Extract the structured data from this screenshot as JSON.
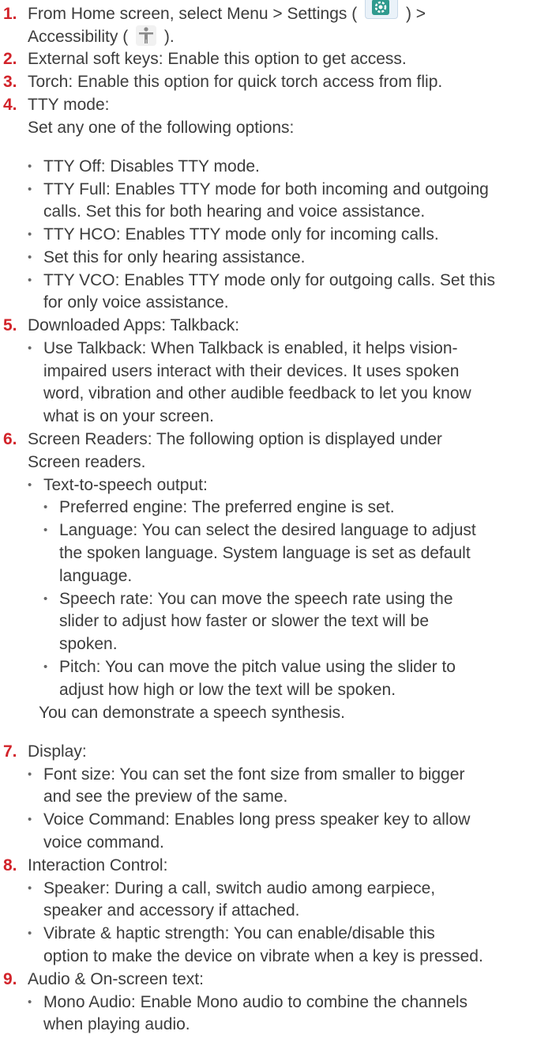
{
  "step1": {
    "num": "1.",
    "text_a": "From Home screen, select Menu > Settings (",
    "text_b": ") >",
    "text_c": "Accessibility (",
    "text_d": ")."
  },
  "step2": {
    "num": "2.",
    "text": "External soft keys: Enable this option to get access."
  },
  "step3": {
    "num": "3.",
    "text": "Torch: Enable this option for quick torch access from flip."
  },
  "step4": {
    "num": "4.",
    "title": "TTY mode:",
    "intro": "Set any one of the following options:",
    "bullets": [
      "TTY Off: Disables TTY mode.",
      "TTY Full: Enables TTY mode for both incoming and outgoing",
      "calls. Set this for both hearing and voice assistance.",
      "TTY HCO: Enables TTY mode only for incoming calls.",
      "Set this for only hearing assistance.",
      "TTY VCO: Enables TTY mode only for outgoing calls. Set this",
      "for only voice assistance."
    ]
  },
  "step5": {
    "num": "5.",
    "title": "Downloaded Apps: Talkback:",
    "lines": [
      "Use Talkback: When Talkback is enabled, it helps vision-",
      "impaired users interact with their devices. It uses spoken",
      "word, vibration and other audible feedback to let you know",
      "what is on your screen."
    ]
  },
  "step6": {
    "num": "6.",
    "lines": [
      "Screen Readers: The following option is displayed under",
      "Screen readers."
    ],
    "sub_title": "Text-to-speech output:",
    "items": [
      "Preferred engine: The preferred engine is set.",
      "Language: You can select the desired language to adjust",
      "the spoken language. System language is set as default",
      "language.",
      "Speech rate: You can move the speech rate using the",
      "slider to adjust how faster or slower the text will be",
      "spoken.",
      "Pitch: You can move the pitch value using the slider to",
      "adjust how high or low the text will be spoken."
    ],
    "note": "You can demonstrate a speech synthesis."
  },
  "step7": {
    "num": "7.",
    "title": "Display:",
    "lines": [
      "Font size: You can set the font size from smaller to bigger",
      "and see the preview of the same.",
      "Voice Command: Enables long press speaker key to allow",
      "voice command."
    ]
  },
  "step8": {
    "num": "8.",
    "title": "Interaction Control:",
    "lines": [
      "Speaker: During a call, switch audio among earpiece,",
      "speaker and accessory if attached.",
      "Vibrate & haptic strength: You can enable/disable this",
      "option to make the device on vibrate when a key is pressed."
    ]
  },
  "step9": {
    "num": "9.",
    "title": "Audio & On-screen text:",
    "lines": [
      "Mono Audio: Enable Mono audio to combine the channels",
      "when playing audio."
    ]
  },
  "colors": {
    "number": "#d2232a",
    "text": "#3c3c3c",
    "settings_icon": "#2f9a8e"
  },
  "icons": {
    "settings": "settings-icon",
    "accessibility": "accessibility-icon"
  }
}
